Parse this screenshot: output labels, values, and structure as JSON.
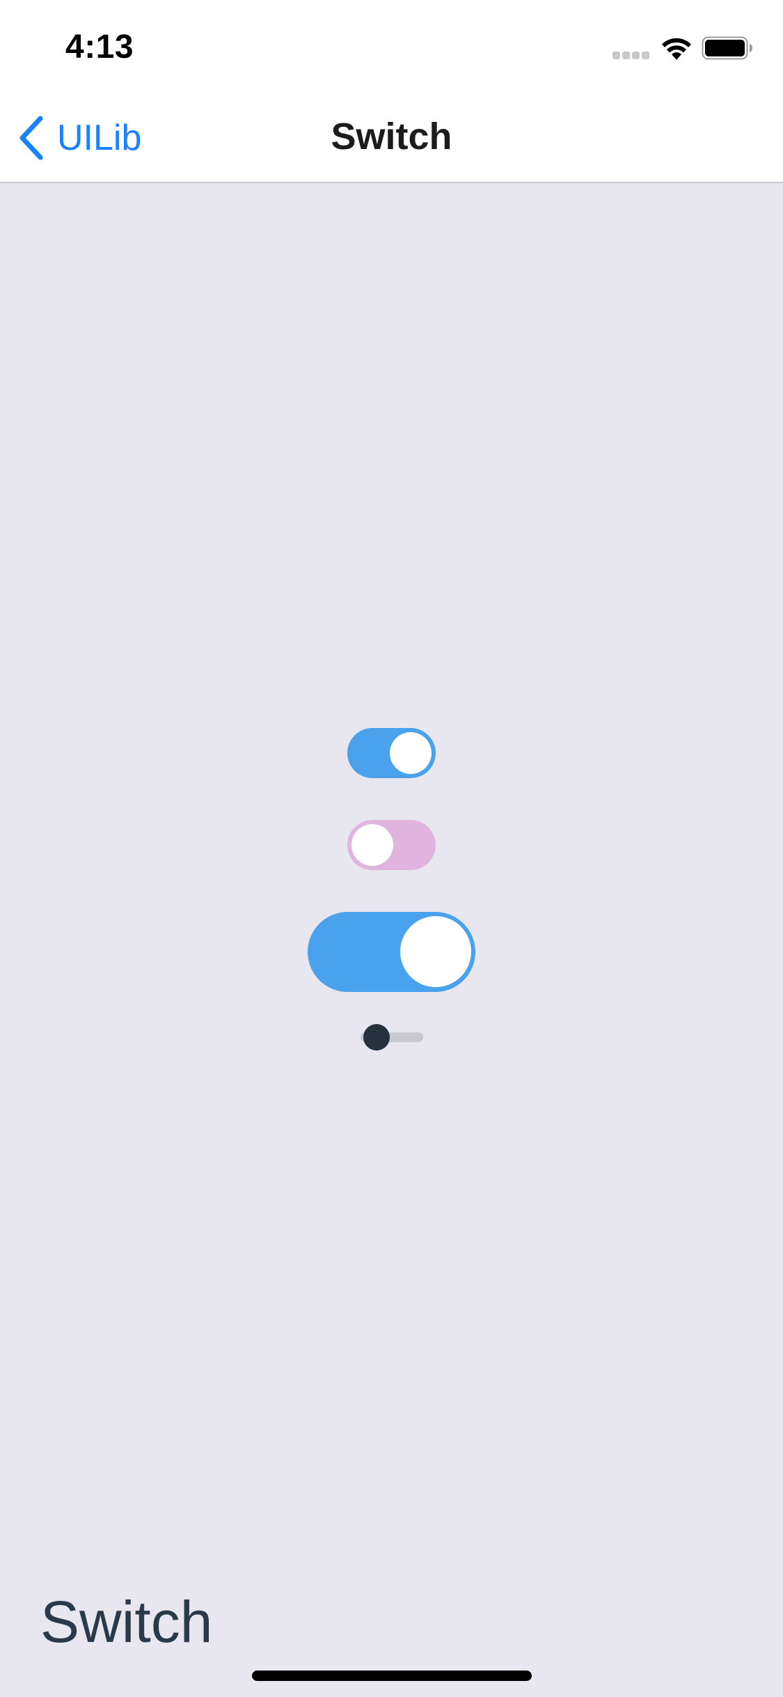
{
  "status_bar": {
    "time": "4:13",
    "icons": [
      "signal-dots-icon",
      "wifi-icon",
      "battery-icon"
    ]
  },
  "nav_bar": {
    "back_label": "UILib",
    "title": "Switch"
  },
  "switches": [
    {
      "name": "switch-1",
      "state": "on",
      "track_color": "#4aa2ec",
      "knob_color": "#ffffff"
    },
    {
      "name": "switch-2",
      "state": "off",
      "track_color": "#e0b4de",
      "knob_color": "#ffffff"
    },
    {
      "name": "switch-3",
      "state": "on",
      "track_color": "#4aa2ec",
      "knob_color": "#ffffff"
    },
    {
      "name": "switch-4",
      "state": "off",
      "track_color": "#c8c9ce",
      "knob_color": "#26313e"
    }
  ],
  "caption": "Switch",
  "colors": {
    "accent": "#1a82fb",
    "background": "#e8e7ef",
    "nav_background": "#ffffff"
  }
}
